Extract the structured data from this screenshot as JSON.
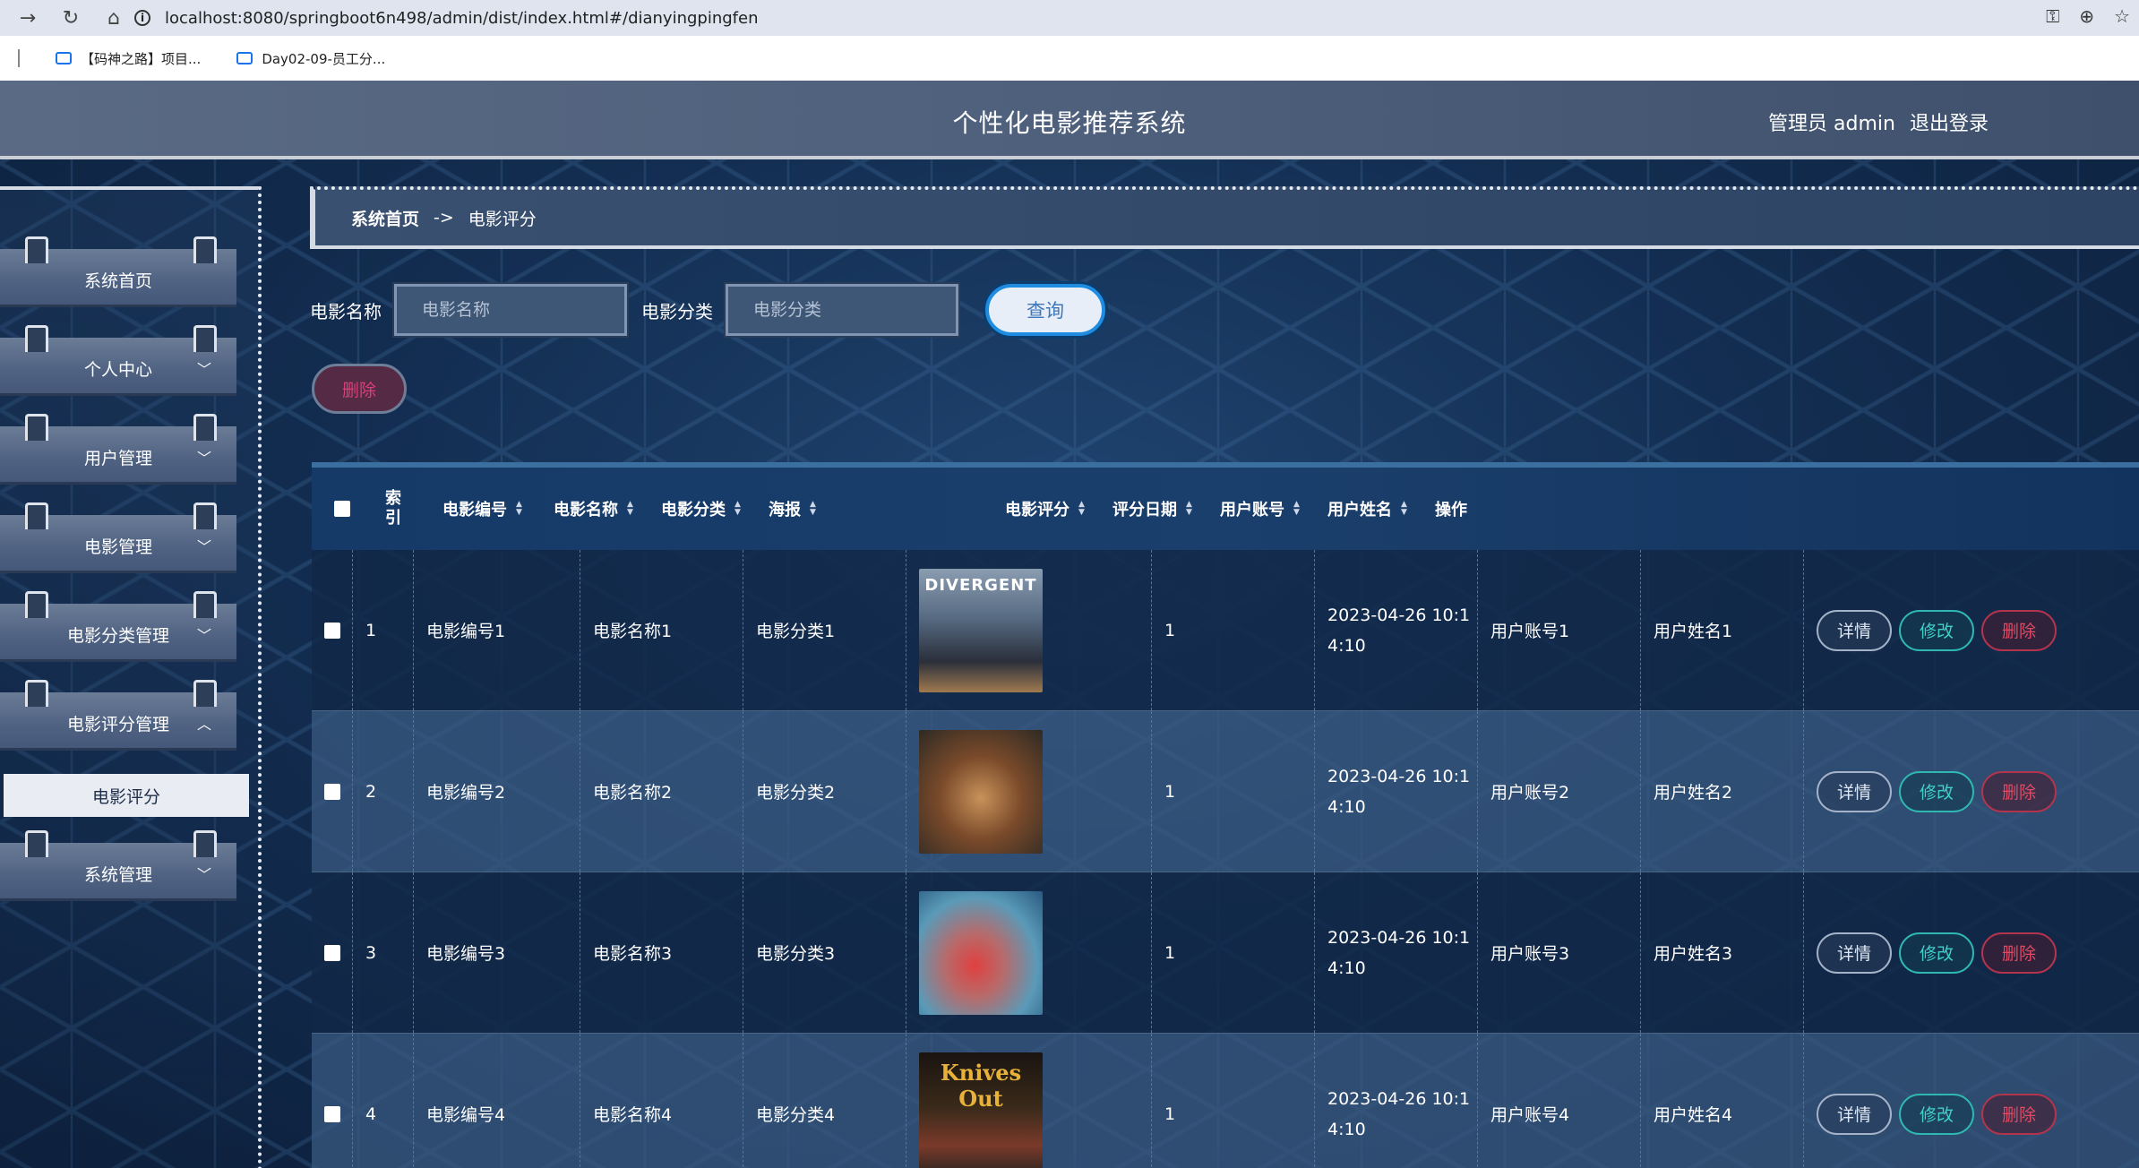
{
  "browser": {
    "url": "localhost:8080/springboot6n498/admin/dist/index.html#/dianyingpingfen",
    "bookmarks": [
      "【码神之路】项目...",
      "Day02-09-员工分..."
    ]
  },
  "header": {
    "title": "个性化电影推荐系统",
    "user_label": "管理员 admin",
    "logout": "退出登录"
  },
  "sidebar": {
    "items": [
      {
        "label": "系统首页",
        "has_chevron": false
      },
      {
        "label": "个人中心",
        "has_chevron": true
      },
      {
        "label": "用户管理",
        "has_chevron": true
      },
      {
        "label": "电影管理",
        "has_chevron": true
      },
      {
        "label": "电影分类管理",
        "has_chevron": true
      },
      {
        "label": "电影评分管理",
        "has_chevron": true,
        "expanded": true
      },
      {
        "label": "系统管理",
        "has_chevron": true
      }
    ],
    "submenu": {
      "label": "电影评分"
    }
  },
  "breadcrumb": {
    "home": "系统首页",
    "separator": "->",
    "current": "电影评分"
  },
  "search": {
    "name_label": "电影名称",
    "name_placeholder": "电影名称",
    "category_label": "电影分类",
    "category_placeholder": "电影分类",
    "query_button": "查询"
  },
  "actions": {
    "delete_button": "删除"
  },
  "table": {
    "headers": {
      "index": "索引",
      "movie_no": "电影编号",
      "movie_name": "电影名称",
      "category": "电影分类",
      "poster": "海报",
      "rating": "电影评分",
      "date": "评分日期",
      "account": "用户账号",
      "username": "用户姓名",
      "ops": "操作"
    },
    "rows": [
      {
        "index": "1",
        "movie_no": "电影编号1",
        "movie_name": "电影名称1",
        "category": "电影分类1",
        "poster_text": "DIVERGENT",
        "rating": "1",
        "date_line1": "2023-04-26 10:1",
        "date_line2": "4:10",
        "account": "用户账号1",
        "username": "用户姓名1"
      },
      {
        "index": "2",
        "movie_no": "电影编号2",
        "movie_name": "电影名称2",
        "category": "电影分类2",
        "poster_text": "",
        "rating": "1",
        "date_line1": "2023-04-26 10:1",
        "date_line2": "4:10",
        "account": "用户账号2",
        "username": "用户姓名2"
      },
      {
        "index": "3",
        "movie_no": "电影编号3",
        "movie_name": "电影名称3",
        "category": "电影分类3",
        "poster_text": "",
        "rating": "1",
        "date_line1": "2023-04-26 10:1",
        "date_line2": "4:10",
        "account": "用户账号3",
        "username": "用户姓名3"
      },
      {
        "index": "4",
        "movie_no": "电影编号4",
        "movie_name": "电影名称4",
        "category": "电影分类4",
        "poster_text": "Knives Out",
        "rating": "1",
        "date_line1": "2023-04-26 10:1",
        "date_line2": "4:10",
        "account": "用户账号4",
        "username": "用户姓名4"
      }
    ],
    "op_labels": {
      "detail": "详情",
      "edit": "修改",
      "delete": "删除"
    }
  },
  "colors": {
    "accent_blue": "#1e8ce0",
    "edit_teal": "#3fd0c8",
    "delete_red": "#e04a63"
  }
}
